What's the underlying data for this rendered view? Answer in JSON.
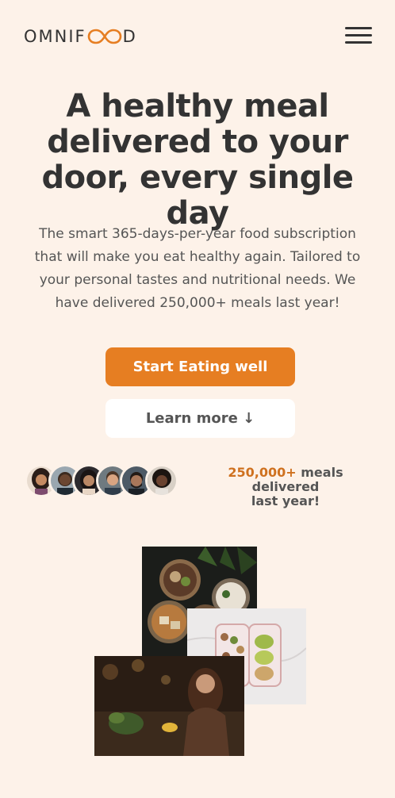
{
  "header": {
    "logo_left": "OMNIF",
    "logo_right": "D",
    "logo_icon": "infinity-icon",
    "menu_icon": "hamburger-menu-icon",
    "accent_color": "#e67e22"
  },
  "hero": {
    "title_line1": "A healthy meal",
    "title_line2": "delivered to your",
    "title_line3": "door, every single day",
    "description_line1": "The smart 365-days-per-year food subscription",
    "description_line2": "that will make you eat healthy again. Tailored to",
    "description_line3": "your personal tastes and nutritional needs. We",
    "description_line4": "have delivered 250,000+ meals last year!",
    "primary_button": "Start Eating well",
    "secondary_button": "Learn more ↓"
  },
  "delivered": {
    "count": "250,000+",
    "text_line1": " meals delivered",
    "text_line2": "last year!"
  },
  "colors": {
    "background": "#fdf2e9",
    "primary": "#e67e22",
    "text": "#333333"
  }
}
